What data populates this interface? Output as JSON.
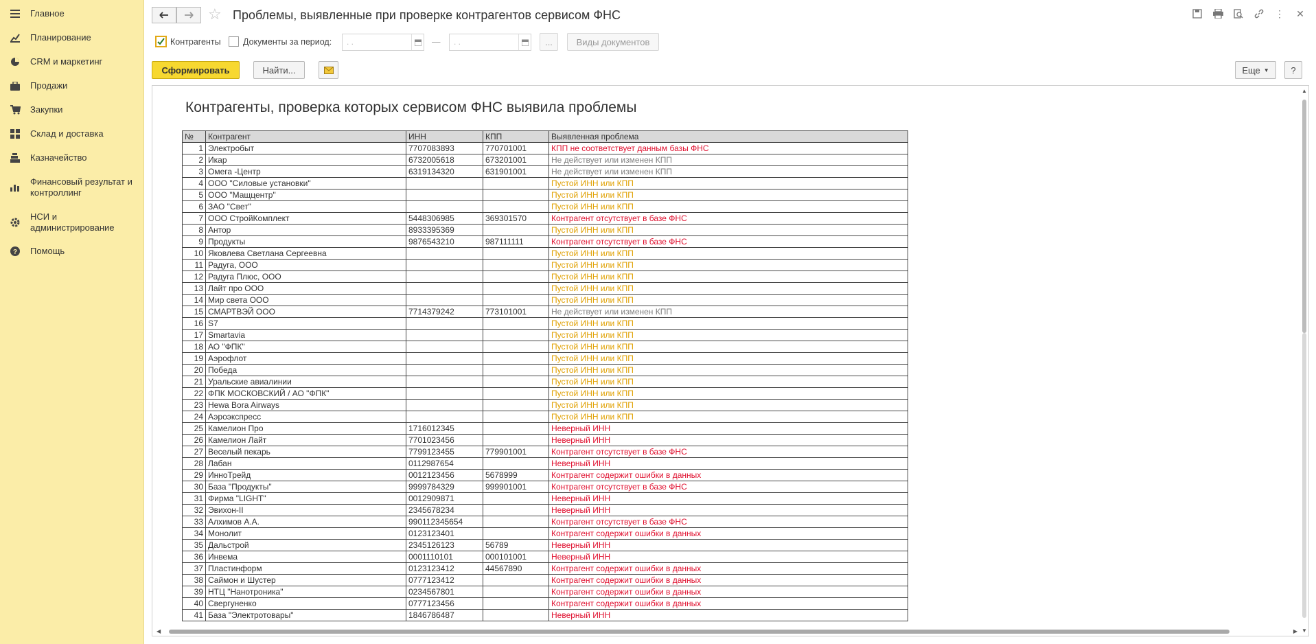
{
  "sidebar": {
    "items": [
      {
        "label": "Главное",
        "icon": "menu-icon"
      },
      {
        "label": "Планирование",
        "icon": "planning-icon"
      },
      {
        "label": "CRM и маркетинг",
        "icon": "pie-chart-icon"
      },
      {
        "label": "Продажи",
        "icon": "briefcase-icon"
      },
      {
        "label": "Закупки",
        "icon": "cart-icon"
      },
      {
        "label": "Склад и доставка",
        "icon": "warehouse-icon"
      },
      {
        "label": "Казначейство",
        "icon": "treasury-icon"
      },
      {
        "label": "Финансовый результат и контроллинг",
        "icon": "bar-chart-icon"
      },
      {
        "label": "НСИ и администрирование",
        "icon": "gear-icon"
      },
      {
        "label": "Помощь",
        "icon": "help-icon"
      }
    ]
  },
  "header": {
    "title": "Проблемы, выявленные при проверке контрагентов сервисом ФНС"
  },
  "filters": {
    "counterparties_label": "Контрагенты",
    "counterparties_checked": true,
    "docs_period_label": "Документы за период:",
    "docs_period_checked": false,
    "date_from": " .  .",
    "date_to": " .  .",
    "dash": "—",
    "ellipsis": "...",
    "doc_types_label": "Виды документов"
  },
  "toolbar": {
    "generate_label": "Сформировать",
    "find_label": "Найти...",
    "more_label": "Еще",
    "help_label": "?"
  },
  "report": {
    "title": "Контрагенты, проверка которых сервисом ФНС выявила проблемы",
    "columns": [
      "№",
      "Контрагент",
      "ИНН",
      "КПП",
      "Выявленная проблема"
    ],
    "rows": [
      [
        "1",
        "Электробыт",
        "7707083893",
        "770701001",
        "КПП не соответствует данным базы ФНС",
        "red"
      ],
      [
        "2",
        "Икар",
        "6732005618",
        "673201001",
        "Не действует или изменен КПП",
        "gray"
      ],
      [
        "3",
        "Омега -Центр",
        "6319134320",
        "631901001",
        "Не действует или изменен КПП",
        "gray"
      ],
      [
        "4",
        "ООО \"Силовые установки\"",
        "",
        "",
        "Пустой ИНН или КПП",
        "gold"
      ],
      [
        "5",
        "ООО \"Мащцентр\"",
        "",
        "",
        "Пустой ИНН или КПП",
        "gold"
      ],
      [
        "6",
        "ЗАО \"Свет\"",
        "",
        "",
        "Пустой ИНН или КПП",
        "gold"
      ],
      [
        "7",
        "ООО СтройКомплект",
        "5448306985",
        "369301570",
        "Контрагент отсутствует в базе ФНС",
        "red"
      ],
      [
        "8",
        "Антор",
        "8933395369",
        "",
        "Пустой ИНН или КПП",
        "gold"
      ],
      [
        "9",
        "Продукты",
        "9876543210",
        "987111111",
        "Контрагент отсутствует в базе ФНС",
        "red"
      ],
      [
        "10",
        "Яковлева Светлана Сергеевна",
        "",
        "",
        "Пустой ИНН или КПП",
        "gold"
      ],
      [
        "11",
        "Радуга, ООО",
        "",
        "",
        "Пустой ИНН или КПП",
        "gold"
      ],
      [
        "12",
        "Радуга Плюс, ООО",
        "",
        "",
        "Пустой ИНН или КПП",
        "gold"
      ],
      [
        "13",
        "Лайт про ООО",
        "",
        "",
        "Пустой ИНН или КПП",
        "gold"
      ],
      [
        "14",
        "Мир света ООО",
        "",
        "",
        "Пустой ИНН или КПП",
        "gold"
      ],
      [
        "15",
        "СМАРТВЭЙ ООО",
        "7714379242",
        "773101001",
        "Не действует или изменен КПП",
        "gray"
      ],
      [
        "16",
        "S7",
        "",
        "",
        "Пустой ИНН или КПП",
        "gold"
      ],
      [
        "17",
        "Smartavia",
        "",
        "",
        "Пустой ИНН или КПП",
        "gold"
      ],
      [
        "18",
        "АО \"ФПК\"",
        "",
        "",
        "Пустой ИНН или КПП",
        "gold"
      ],
      [
        "19",
        "Аэрофлот",
        "",
        "",
        "Пустой ИНН или КПП",
        "gold"
      ],
      [
        "20",
        "Победа",
        "",
        "",
        "Пустой ИНН или КПП",
        "gold"
      ],
      [
        "21",
        "Уральские авиалинии",
        "",
        "",
        "Пустой ИНН или КПП",
        "gold"
      ],
      [
        "22",
        "ФПК МОСКОВСКИЙ / АО \"ФПК\"",
        "",
        "",
        "Пустой ИНН или КПП",
        "gold"
      ],
      [
        "23",
        "Hewa Bora Airways",
        "",
        "",
        "Пустой ИНН или КПП",
        "gold"
      ],
      [
        "24",
        "Аэроэкспресс",
        "",
        "",
        "Пустой ИНН или КПП",
        "gold"
      ],
      [
        "25",
        "Камелион Про",
        "1716012345",
        "",
        "Неверный ИНН",
        "red"
      ],
      [
        "26",
        "Камелион Лайт",
        "7701023456",
        "",
        "Неверный ИНН",
        "red"
      ],
      [
        "27",
        "Веселый пекарь",
        "7799123455",
        "779901001",
        "Контрагент отсутствует в базе ФНС",
        "red"
      ],
      [
        "28",
        "Лабан",
        "0112987654",
        "",
        "Неверный ИНН",
        "red"
      ],
      [
        "29",
        "ИнноТрейд",
        "0012123456",
        "5678999",
        "Контрагент содержит ошибки в данных",
        "red"
      ],
      [
        "30",
        "База \"Продукты\"",
        "9999784329",
        "999901001",
        "Контрагент отсутствует в базе ФНС",
        "red"
      ],
      [
        "31",
        "Фирма \"LIGHT\"",
        "0012909871",
        "",
        "Неверный ИНН",
        "red"
      ],
      [
        "32",
        "Эвихон-II",
        "2345678234",
        "",
        "Неверный ИНН",
        "red"
      ],
      [
        "33",
        "Алхимов А.А.",
        "990112345654",
        "",
        "Контрагент отсутствует в базе ФНС",
        "red"
      ],
      [
        "34",
        "Монолит",
        "0123123401",
        "",
        "Контрагент содержит ошибки в данных",
        "red"
      ],
      [
        "35",
        "Дальстрой",
        "2345126123",
        "56789",
        "Неверный ИНН",
        "red"
      ],
      [
        "36",
        "Инвема",
        "0001110101",
        "000101001",
        "Неверный ИНН",
        "red"
      ],
      [
        "37",
        "Пластинформ",
        "0123123412",
        "44567890",
        "Контрагент содержит ошибки в данных",
        "red"
      ],
      [
        "38",
        "Саймон и Шустер",
        "0777123412",
        "",
        "Контрагент содержит ошибки в данных",
        "red"
      ],
      [
        "39",
        "НТЦ \"Нанотроника\"",
        "0234567801",
        "",
        "Контрагент содержит ошибки в данных",
        "red"
      ],
      [
        "40",
        "Свергуненко",
        "0777123456",
        "",
        "Контрагент содержит ошибки в данных",
        "red"
      ],
      [
        "41",
        "База \"Электротовары\"",
        "1846786487",
        "",
        "Неверный ИНН",
        "red"
      ]
    ]
  },
  "colors": {
    "sidebar_bg": "#fbeda8",
    "primary_button": "#f7d830",
    "problem_red": "#e0102f",
    "problem_gold": "#e0a000",
    "problem_gray": "#808080",
    "header_row": "#d9d9d9"
  }
}
